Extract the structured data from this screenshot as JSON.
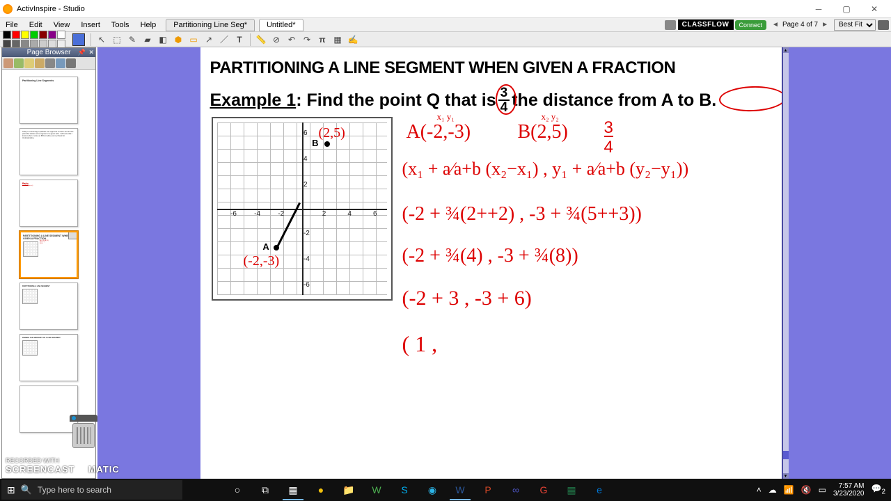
{
  "app": {
    "title": "ActivInspire - Studio"
  },
  "menu": {
    "file": "File",
    "edit": "Edit",
    "view": "View",
    "insert": "Insert",
    "tools": "Tools",
    "help": "Help"
  },
  "tabs": {
    "doc1": "Partitioning Line Seg*",
    "doc2": "Untitled*"
  },
  "header_right": {
    "classflow": "CLASSFLOW",
    "connect": "Connect",
    "page": "Page 4 of 7",
    "zoom": "Best Fit"
  },
  "page_browser": {
    "title": "Page Browser"
  },
  "thumbs": {
    "t1": "Partitioning Line Segments",
    "t1b": "",
    "t2": "Today I am learning to partition line segments so that I can find the point that divides a line segment in a given ratio. I will know that I know it when I score an 80% or above on my Check for Understanding.",
    "t3": "",
    "t4": "PARTITIONING A LINE SEGMENT WHEN GIVEN A FRACTION",
    "t5": "",
    "t6": ""
  },
  "content": {
    "title": "PARTITIONING A LINE SEGMENT WHEN GIVEN A FRACTION",
    "example_label": "Example 1",
    "example_prefix": ": Find the point Q that is",
    "frac_num": "3",
    "frac_den": "4",
    "example_suffix": "the distance from",
    "atob": "A to B.",
    "graph": {
      "ptA": "A",
      "ptB": "B",
      "ticks_x": [
        "-6",
        "-4",
        "-2",
        "2",
        "4",
        "6"
      ],
      "ticks_y": [
        "6",
        "4",
        "2",
        "-2",
        "-4",
        "-6"
      ]
    },
    "ink": {
      "pB": "(2,5)",
      "pA": "(-2,-3)",
      "subA": "x₁ y₁",
      "subB": "x₂ y₂",
      "lineA": "A(-2,-3)",
      "lineB": "B(2,5)",
      "frac34": "3/4",
      "formula": "(x₁ + a⁄a+b (x₂−x₁) ,  y₁ + a⁄a+b (y₂−y₁))",
      "step2": "(-2 + ¾(2++2) ,  -3 + ¾(5++3))",
      "step3": "(-2 + ¾(4) ,  -3 + ¾(8))",
      "step4": "(-2 + 3 , -3 + 6)",
      "step5": "( 1 ,"
    }
  },
  "scm": {
    "recorded": "RECORDED WITH",
    "brand": "SCREENCAST",
    "matic": "MATIC"
  },
  "taskbar": {
    "search": "Type here to search",
    "time": "7:57 AM",
    "date": "3/23/2020",
    "notif": "2"
  }
}
